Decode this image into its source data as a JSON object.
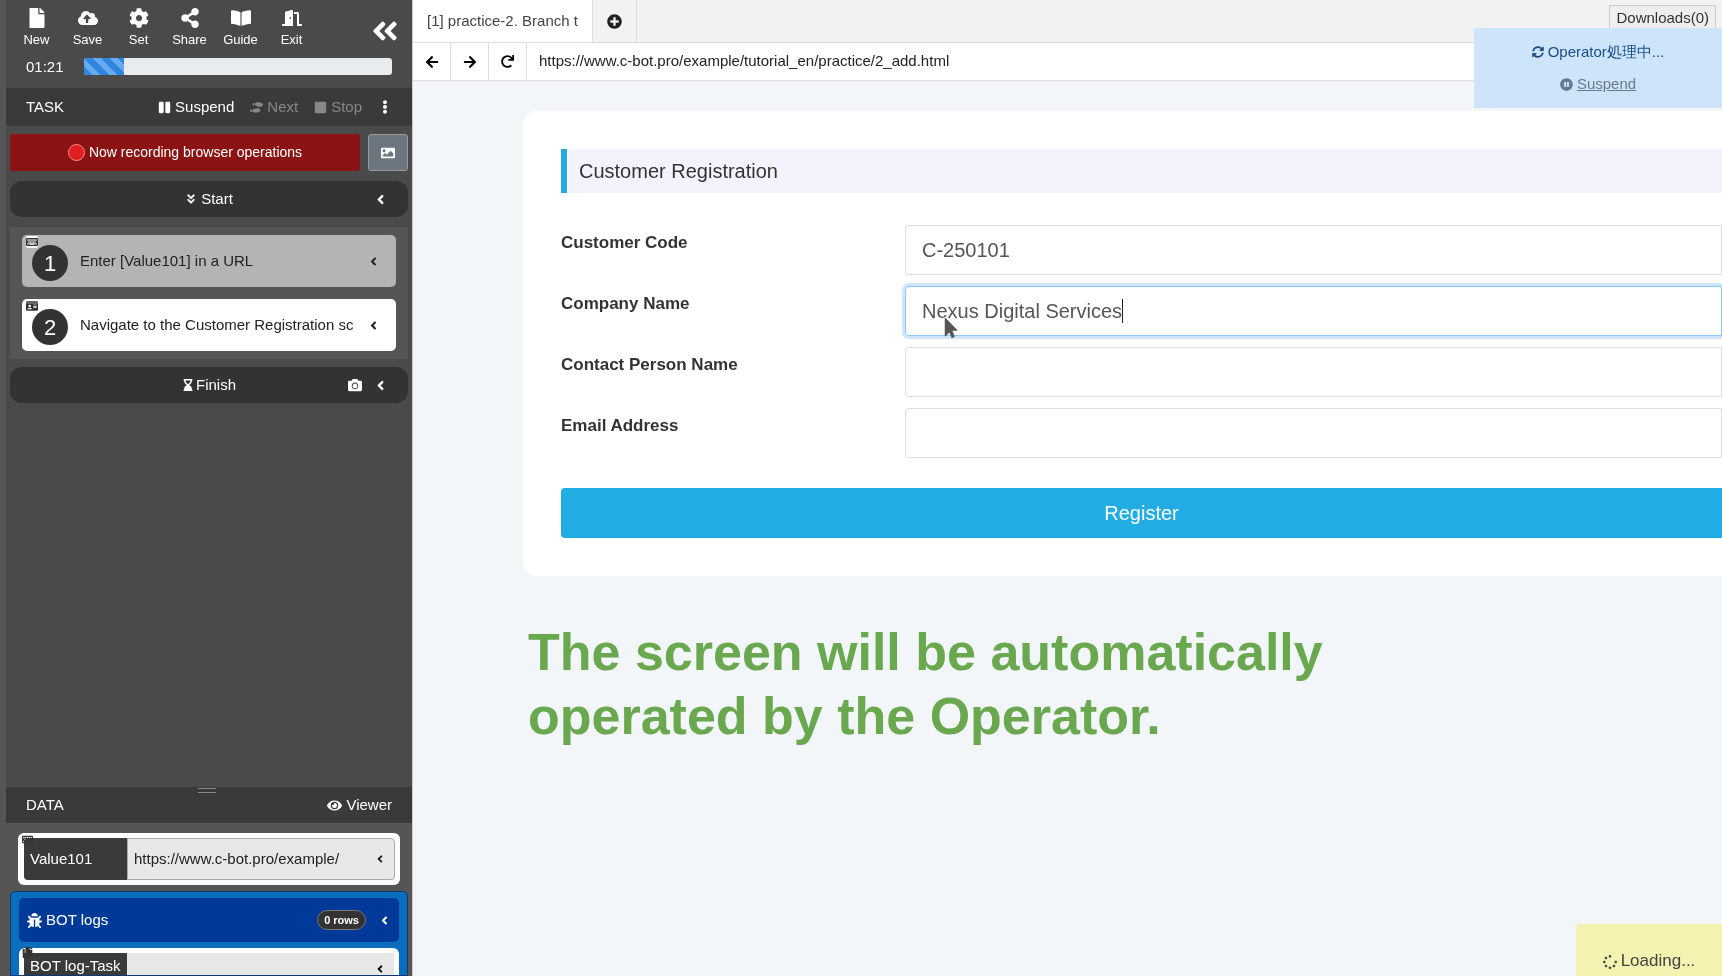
{
  "sidebar": {
    "toolbar": [
      {
        "label": "New",
        "kind": "file"
      },
      {
        "label": "Save",
        "kind": "cloud"
      },
      {
        "label": "Set",
        "kind": "gear"
      },
      {
        "label": "Share",
        "kind": "share"
      },
      {
        "label": "Guide",
        "kind": "book"
      },
      {
        "label": "Exit",
        "kind": "door"
      }
    ],
    "timer": "01:21",
    "progress": {
      "level": 0.13
    },
    "task_bar": {
      "title": "TASK",
      "actions": [
        {
          "label": "Suspend",
          "kind": "pause",
          "disabled": false
        },
        {
          "label": "Next",
          "kind": "steps",
          "disabled": true
        },
        {
          "label": "Stop",
          "kind": "stop",
          "disabled": true
        }
      ]
    },
    "recording": "Now recording browser operations",
    "start": "Start",
    "steps": [
      {
        "number": "1",
        "text": "Enter [Value101] in a URL",
        "kind": "keyboard",
        "completed": true
      },
      {
        "number": "2",
        "text": "Navigate to the Customer Registration sc",
        "kind": "card",
        "completed": false
      }
    ],
    "finish": "Finish",
    "data_bar": {
      "title": "DATA",
      "viewer": "Viewer"
    },
    "values": [
      {
        "name": "Value101",
        "value": "https://www.c-bot.pro/example/"
      }
    ],
    "bot_logs": {
      "title": "BOT logs",
      "count": "0 rows",
      "items": [
        {
          "name": "BOT log-Task"
        }
      ]
    }
  },
  "browser": {
    "tabs": [
      {
        "label": "[1] practice-2. Branch t",
        "selected": true
      }
    ],
    "downloads": "Downloads(0)",
    "url": "https://www.c-bot.pro/example/tutorial_en/practice/2_add.html",
    "operator": {
      "status": "Operator処理中...",
      "suspend": "Suspend"
    },
    "form": {
      "title": "Customer Registration",
      "fields": [
        {
          "label": "Customer Code",
          "value": "C-250101",
          "focused": false
        },
        {
          "label": "Company Name",
          "value": "Nexus Digital Services",
          "focused": true
        },
        {
          "label": "Contact Person Name",
          "focused": false
        },
        {
          "label": "Email Address",
          "focused": false
        }
      ],
      "button": "Register"
    },
    "notice": "The screen will be automatically operated by the Operator.",
    "loading": "Loading..."
  }
}
